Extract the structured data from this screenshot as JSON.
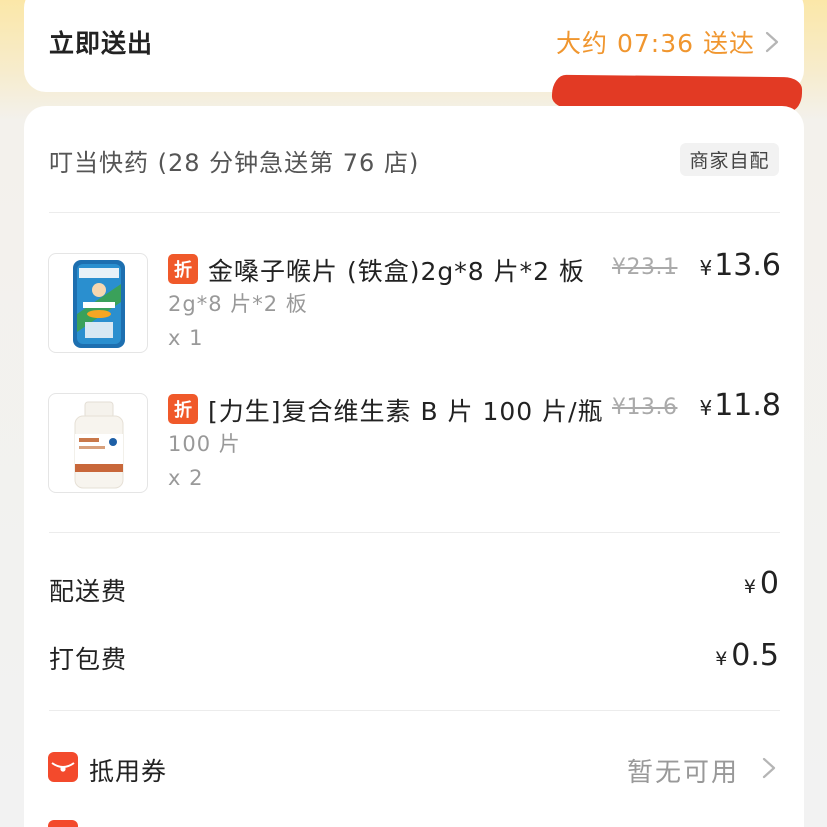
{
  "delivery": {
    "label": "立即送出",
    "eta": "大约 07:36 送达",
    "accent_color": "#f0962f"
  },
  "store": {
    "name": "叮当快药 (28 分钟急送第 76 店)",
    "tag": "商家自配"
  },
  "products": [
    {
      "badge": "折",
      "name": "金嗓子喉片 (铁盒)2g*8 片*2 板",
      "spec": "2g*8 片*2 板",
      "qty": "x 1",
      "original_price": "¥23.1",
      "currency": "¥",
      "price": "13.6",
      "image_icon": "throat-lozenge-tin-image"
    },
    {
      "badge": "折",
      "name": "[力生]复合维生素 B 片 100 片/瓶",
      "spec": "100 片",
      "qty": "x 2",
      "original_price": "¥13.6",
      "currency": "¥",
      "price": "11.8",
      "image_icon": "vitamin-bottle-image"
    }
  ],
  "fees": {
    "delivery_label": "配送费",
    "delivery_currency": "¥",
    "delivery_value": "0",
    "packing_label": "打包费",
    "packing_currency": "¥",
    "packing_value": "0.5"
  },
  "coupon": {
    "label": "抵用券",
    "value": "暂无可用",
    "icon": "coupon-icon",
    "icon_color": "#f34a2c"
  }
}
